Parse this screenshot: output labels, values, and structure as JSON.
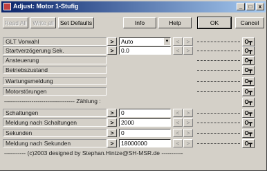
{
  "window": {
    "title": "Adjust: Motor 1-Stufig",
    "minimize": "_",
    "maximize": "□",
    "close": "x"
  },
  "toolbar": {
    "read_all": "Read All",
    "write_all": "Write all",
    "set_defaults": "Set Defaults",
    "info": "Info",
    "help": "Help",
    "ok": "OK",
    "cancel": "Cancel"
  },
  "rows": [
    {
      "label": "GLT Vorwahl",
      "value": "Auto"
    },
    {
      "label": "Startverzögerung Sek.",
      "value": "0.0"
    },
    {
      "label": "Ansteuerung"
    },
    {
      "label": "Betriebszustand"
    },
    {
      "label": "Wartungsmeldung"
    },
    {
      "label": "Motorstörungen"
    }
  ],
  "section": {
    "label": "------------------------------------ Zählung :"
  },
  "counter_rows": [
    {
      "label": "Schaltungen",
      "value": "0"
    },
    {
      "label": "Meldung nach Schaltungen",
      "value": "2000"
    },
    {
      "label": "Sekunden",
      "value": "0"
    },
    {
      "label": "Meldung nach Sekunden",
      "value": "18000000"
    }
  ],
  "footer": {
    "text": "----------- (c)2003 designed by Stephan.Hintze@SH-MSR.de -----------"
  },
  "glyphs": {
    "go": ">",
    "spin_left": "<",
    "spin_right": ">",
    "key": "O┳",
    "combo": "▼"
  }
}
